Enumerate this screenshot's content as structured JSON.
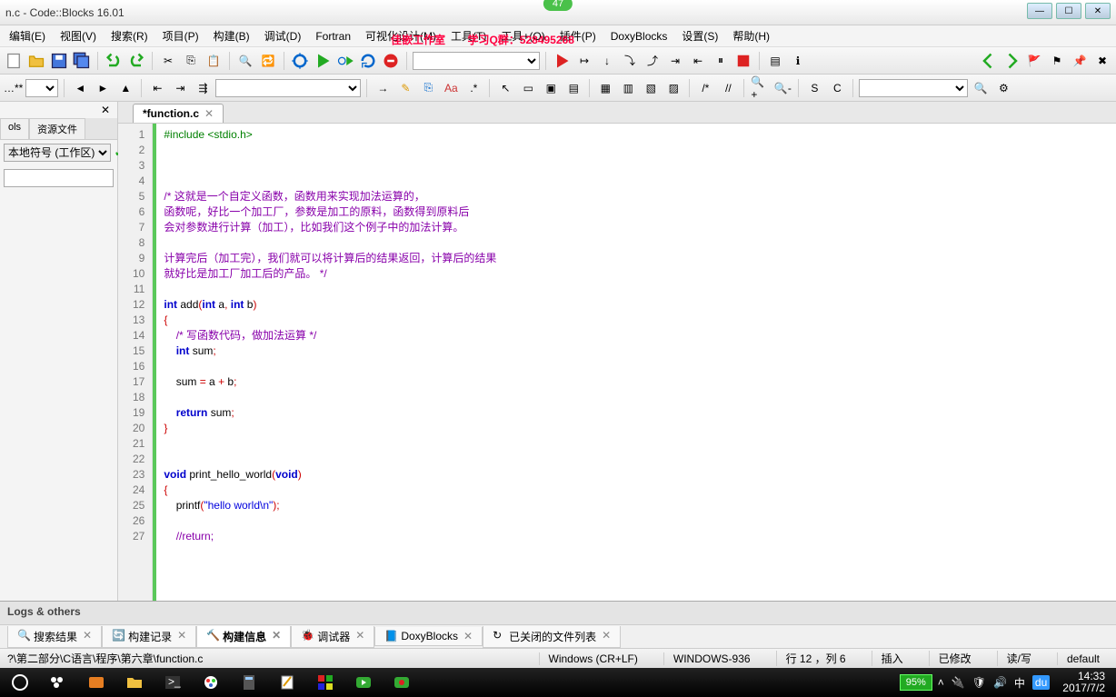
{
  "window": {
    "title": "n.c - Code::Blocks 16.01",
    "bubble": "47"
  },
  "overlay": {
    "text1": "佳嵌工作室",
    "text2": "学习Q群：528495268"
  },
  "menubar": [
    "编辑(E)",
    "视图(V)",
    "搜索(R)",
    "项目(P)",
    "构建(B)",
    "调试(D)",
    "Fortran",
    "可视化设计(M)",
    "工具(T)",
    "工具+(O)",
    "插件(P)",
    "DoxyBlocks",
    "设置(S)",
    "帮助(H)"
  ],
  "leftpanel": {
    "tabs": [
      "ols",
      "资源文件"
    ],
    "dropdown": "本地符号 (工作区)"
  },
  "editor": {
    "tab_label": "*function.c",
    "lines": [
      {
        "n": 1,
        "t": "preproc",
        "s": "#include <stdio.h>"
      },
      {
        "n": 2,
        "t": "",
        "s": ""
      },
      {
        "n": 3,
        "t": "",
        "s": ""
      },
      {
        "n": 4,
        "t": "",
        "s": ""
      },
      {
        "n": 5,
        "t": "comment",
        "s": "/* 这就是一个自定义函数，函数用来实现加法运算的，"
      },
      {
        "n": 6,
        "t": "comment",
        "s": "函数呢，好比一个加工厂，参数是加工的原料，函数得到原料后"
      },
      {
        "n": 7,
        "t": "comment",
        "s": "会对参数进行计算（加工），比如我们这个例子中的加法计算。"
      },
      {
        "n": 8,
        "t": "",
        "s": ""
      },
      {
        "n": 9,
        "t": "comment",
        "s": "计算完后（加工完），我们就可以将计算后的结果返回，计算后的结果"
      },
      {
        "n": 10,
        "t": "comment",
        "s": "就好比是加工厂加工后的产品。 */"
      },
      {
        "n": 11,
        "t": "",
        "s": ""
      },
      {
        "n": 12,
        "t": "code",
        "s": "int add(int a, int b)"
      },
      {
        "n": 13,
        "t": "punc",
        "s": "{"
      },
      {
        "n": 14,
        "t": "comment",
        "s": "    /* 写函数代码，做加法运算 */"
      },
      {
        "n": 15,
        "t": "code",
        "s": "    int sum;"
      },
      {
        "n": 16,
        "t": "",
        "s": ""
      },
      {
        "n": 17,
        "t": "code",
        "s": "    sum = a + b;"
      },
      {
        "n": 18,
        "t": "",
        "s": ""
      },
      {
        "n": 19,
        "t": "code",
        "s": "    return sum;"
      },
      {
        "n": 20,
        "t": "punc",
        "s": "}"
      },
      {
        "n": 21,
        "t": "",
        "s": ""
      },
      {
        "n": 22,
        "t": "",
        "s": ""
      },
      {
        "n": 23,
        "t": "code",
        "s": "void print_hello_world(void)"
      },
      {
        "n": 24,
        "t": "punc",
        "s": "{"
      },
      {
        "n": 25,
        "t": "code",
        "s": "    printf(\"hello world\\n\");"
      },
      {
        "n": 26,
        "t": "",
        "s": ""
      },
      {
        "n": 27,
        "t": "comment",
        "s": "    //return;"
      }
    ]
  },
  "logs": {
    "title": "Logs & others"
  },
  "logtabs": [
    {
      "icon": "search",
      "label": "搜索结果",
      "active": false
    },
    {
      "icon": "cycle",
      "label": "构建记录",
      "active": false
    },
    {
      "icon": "hammer",
      "label": "构建信息",
      "active": true
    },
    {
      "icon": "bug",
      "label": "调试器",
      "active": false
    },
    {
      "icon": "doxy",
      "label": "DoxyBlocks",
      "active": false
    },
    {
      "icon": "reload",
      "label": "已关闭的文件列表",
      "active": false
    }
  ],
  "statusbar": {
    "path": "?\\第二部分\\C语言\\程序\\第六章\\function.c",
    "eol": "Windows (CR+LF)",
    "enc": "WINDOWS-936",
    "pos": "行 12 ，列 6",
    "ins": "插入",
    "mod": "已修改",
    "rw": "读/写",
    "profile": "default"
  },
  "taskbar": {
    "battery": "95%",
    "time": "14:33",
    "date": "2017/7/2"
  }
}
